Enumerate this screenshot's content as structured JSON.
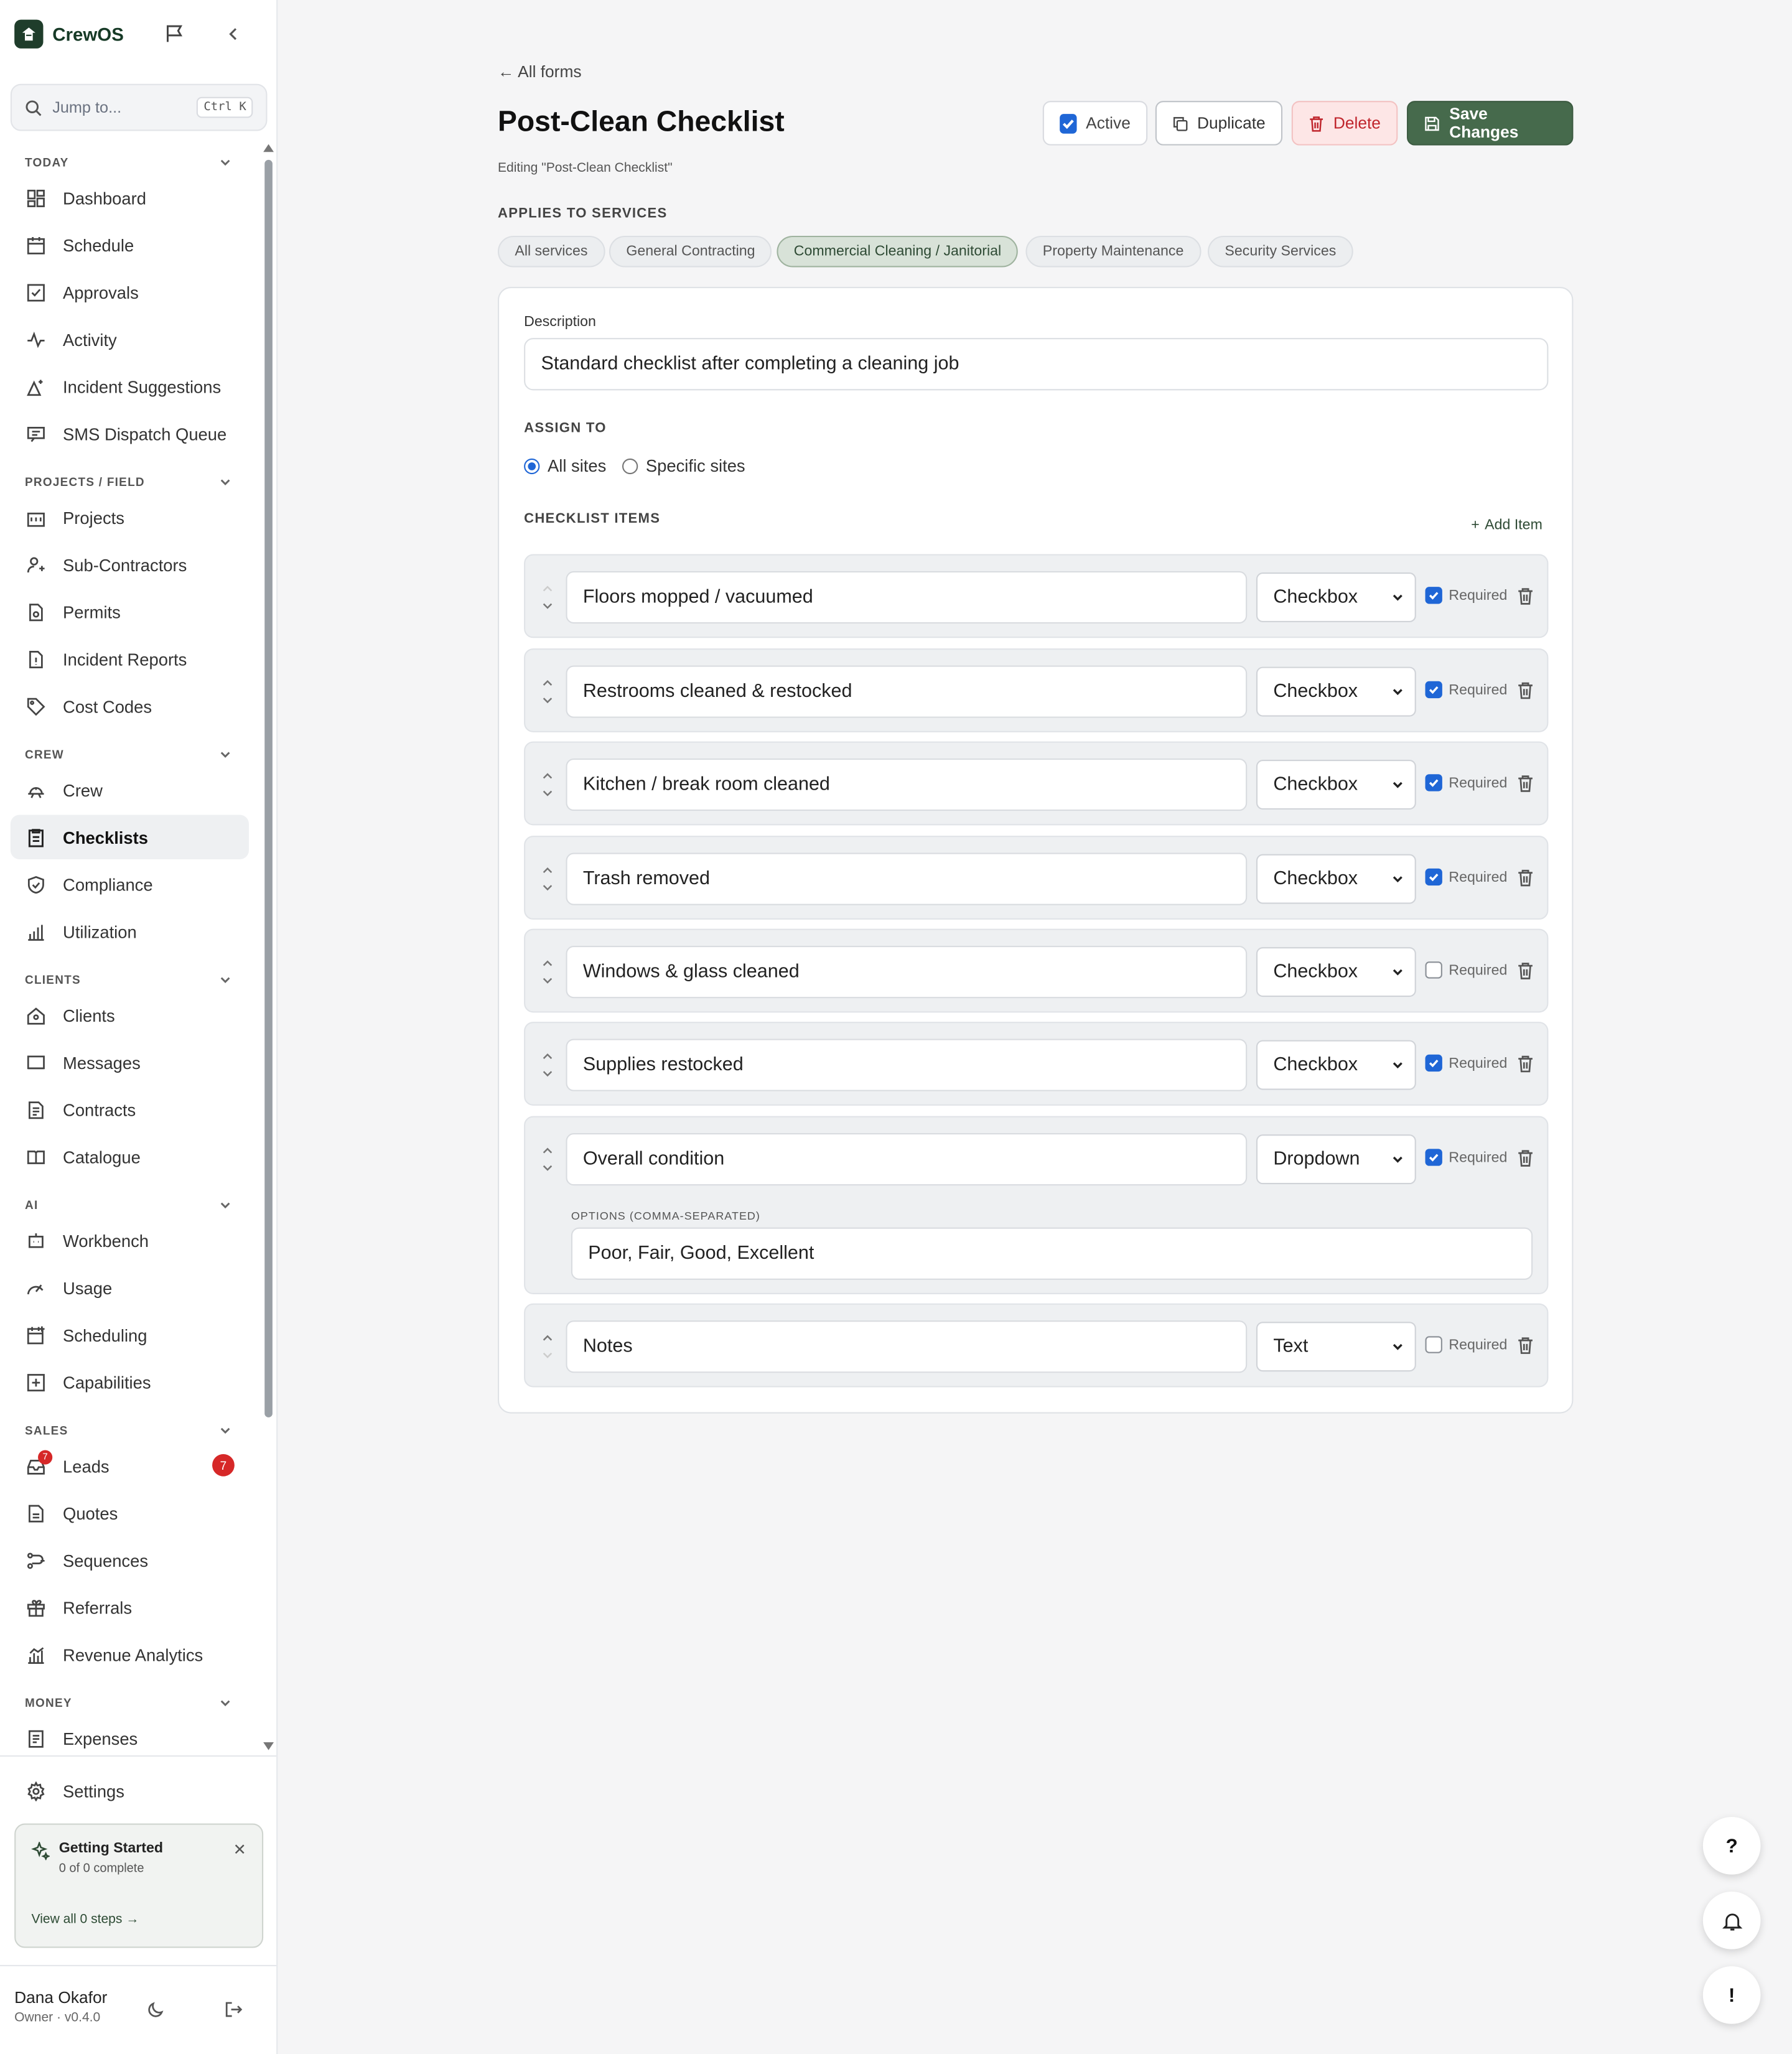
{
  "app": {
    "name": "CrewOS"
  },
  "sidebar": {
    "search_placeholder": "Jump to...",
    "search_shortcut": "Ctrl K",
    "sections": {
      "today": "TODAY",
      "projects": "PROJECTS / FIELD",
      "crew": "CREW",
      "clients": "CLIENTS",
      "ai": "AI",
      "sales": "SALES",
      "money": "MONEY"
    },
    "items": {
      "dashboard": "Dashboard",
      "schedule": "Schedule",
      "approvals": "Approvals",
      "activity": "Activity",
      "incident_suggestions": "Incident Suggestions",
      "sms_dispatch": "SMS Dispatch Queue",
      "projects": "Projects",
      "subcontractors": "Sub-Contractors",
      "permits": "Permits",
      "incident_reports": "Incident Reports",
      "cost_codes": "Cost Codes",
      "crew": "Crew",
      "checklists": "Checklists",
      "compliance": "Compliance",
      "utilization": "Utilization",
      "clients": "Clients",
      "messages": "Messages",
      "contracts": "Contracts",
      "catalogue": "Catalogue",
      "workbench": "Workbench",
      "usage": "Usage",
      "scheduling": "Scheduling",
      "capabilities": "Capabilities",
      "leads": "Leads",
      "quotes": "Quotes",
      "sequences": "Sequences",
      "referrals": "Referrals",
      "revenue_analytics": "Revenue Analytics",
      "expenses": "Expenses"
    },
    "leads_badge": "7",
    "settings": "Settings",
    "getting_started": {
      "title": "Getting Started",
      "progress": "0 of 0 complete",
      "link": "View all 0 steps →"
    },
    "user": {
      "name": "Dana Okafor",
      "meta": "Owner · v0.4.0"
    }
  },
  "page": {
    "back_link": "← All forms",
    "title": "Post-Clean Checklist",
    "editing_note": "Editing \"Post-Clean Checklist\"",
    "buttons": {
      "active": "Active",
      "duplicate": "Duplicate",
      "delete": "Delete",
      "save": "Save Changes"
    },
    "applies_label": "APPLIES TO SERVICES",
    "services": [
      "All services",
      "General Contracting",
      "Commercial Cleaning / Janitorial",
      "Property Maintenance",
      "Security Services"
    ],
    "selected_service": "Commercial Cleaning / Janitorial",
    "description_label": "Description",
    "description_value": "Standard checklist after completing a cleaning job",
    "assign_label": "ASSIGN TO",
    "assign_options": {
      "all": "All sites",
      "specific": "Specific sites"
    },
    "assign_selected": "All sites",
    "items_label": "CHECKLIST ITEMS",
    "add_item": "Add Item",
    "required_label": "Required",
    "options_label": "OPTIONS (COMMA-SEPARATED)",
    "items": [
      {
        "label": "Floors mopped / vacuumed",
        "type": "Checkbox",
        "required": true
      },
      {
        "label": "Restrooms cleaned & restocked",
        "type": "Checkbox",
        "required": true
      },
      {
        "label": "Kitchen / break room cleaned",
        "type": "Checkbox",
        "required": true
      },
      {
        "label": "Trash removed",
        "type": "Checkbox",
        "required": true
      },
      {
        "label": "Windows & glass cleaned",
        "type": "Checkbox",
        "required": false
      },
      {
        "label": "Supplies restocked",
        "type": "Checkbox",
        "required": true
      },
      {
        "label": "Overall condition",
        "type": "Dropdown",
        "required": true,
        "options": "Poor, Fair, Good, Excellent"
      },
      {
        "label": "Notes",
        "type": "Text",
        "required": false
      }
    ]
  },
  "fabs": {
    "help": "?",
    "alert": "!"
  },
  "colors": {
    "accent": "#466a4c",
    "danger": "#c0262d",
    "checkbox": "#1f66d6"
  }
}
